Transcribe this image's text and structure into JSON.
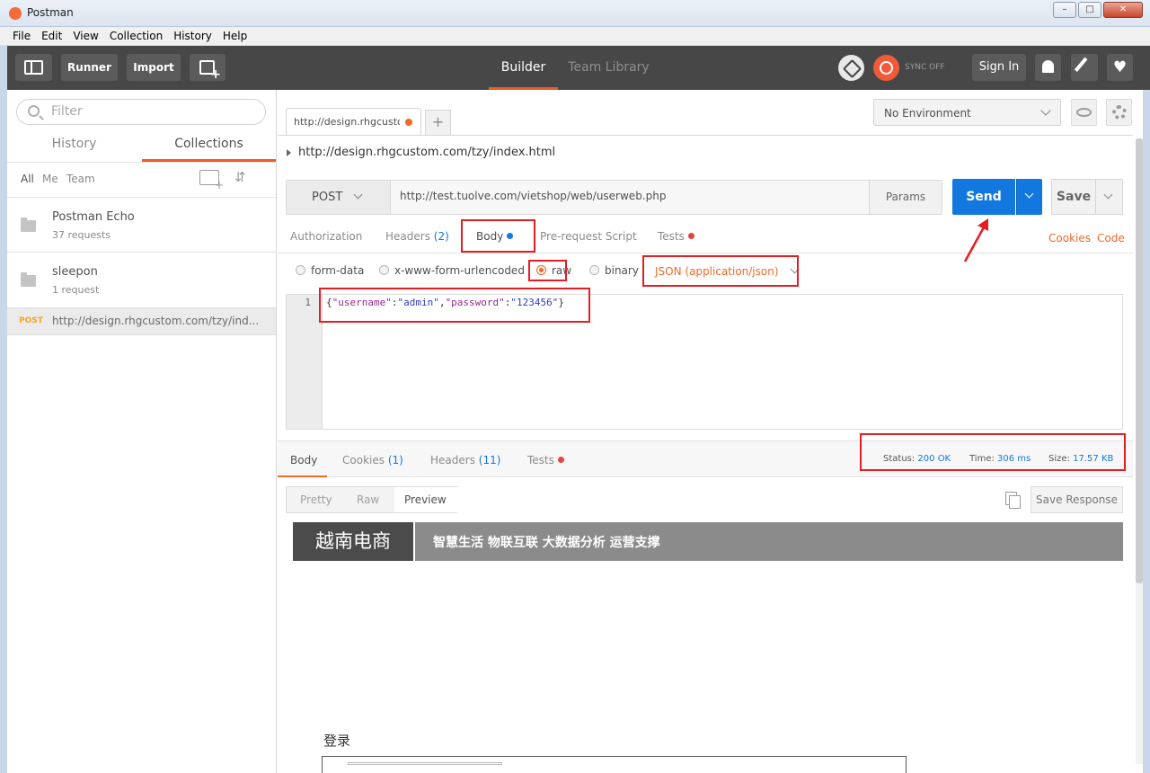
{
  "window": {
    "title": "Postman",
    "controls": {
      "minimize": "–",
      "maximize": "□",
      "close": "✕"
    }
  },
  "menu": [
    "File",
    "Edit",
    "View",
    "Collection",
    "History",
    "Help"
  ],
  "header": {
    "runner": "Runner",
    "import": "Import",
    "tabs": {
      "builder": "Builder",
      "team_library": "Team Library"
    },
    "sync": "SYNC OFF",
    "sign_in": "Sign In",
    "heart": "♥"
  },
  "sidebar": {
    "filter_placeholder": "Filter",
    "tabs": {
      "history": "History",
      "collections": "Collections"
    },
    "owner_filters": {
      "all": "All",
      "me": "Me",
      "team": "Team"
    },
    "sort_icon": "⇵",
    "collections": [
      {
        "name": "Postman Echo",
        "count": "37 requests"
      },
      {
        "name": "sleepon",
        "count": "1 request"
      }
    ],
    "history_item": {
      "method": "POST",
      "url": "http://design.rhgcustom.com/tzy/ind..."
    }
  },
  "request_tab": {
    "label": "http://design.rhgcustc",
    "add": "+"
  },
  "environment": {
    "selected": "No Environment"
  },
  "request": {
    "title_url": "http://design.rhgcustom.com/tzy/index.html",
    "method": "POST",
    "url": "http://test.tuolve.com/vietshop/web/userweb.php",
    "params": "Params",
    "send": "Send",
    "save": "Save",
    "tabs": {
      "authorization": "Authorization",
      "headers": "Headers",
      "headers_count": "(2)",
      "body": "Body",
      "pre_request": "Pre-request Script",
      "tests": "Tests"
    },
    "links": {
      "cookies": "Cookies",
      "code": "Code"
    },
    "body_modes": {
      "form_data": "form-data",
      "urlencoded": "x-www-form-urlencoded",
      "raw": "raw",
      "binary": "binary"
    },
    "content_type": "JSON (application/json)",
    "editor": {
      "line_number": "1",
      "p1": "{",
      "k1": "\"username\"",
      "c1": ":",
      "v1": "\"admin\"",
      "c2": ",",
      "k2": "\"password\"",
      "c3": ":",
      "v2": "\"123456\"",
      "p2": "}"
    }
  },
  "response": {
    "tabs": {
      "body": "Body",
      "cookies": "Cookies",
      "cookies_count": "(1)",
      "headers": "Headers",
      "headers_count": "(11)",
      "tests": "Tests"
    },
    "status_label": "Status:",
    "status_value": "200 OK",
    "time_label": "Time:",
    "time_value": "306 ms",
    "size_label": "Size:",
    "size_value": "17.57 KB",
    "view_tabs": {
      "pretty": "Pretty",
      "raw": "Raw",
      "preview": "Preview"
    },
    "save_response": "Save Response",
    "preview": {
      "brand": "越南电商",
      "tagline": "智慧生活 物联互联 大数据分析 运营支撑",
      "login": "登录"
    }
  },
  "colors": {
    "accent": "#ef6a25",
    "send_blue": "#1278df",
    "header_bg": "#474747",
    "annotation_red": "#e31d22"
  }
}
